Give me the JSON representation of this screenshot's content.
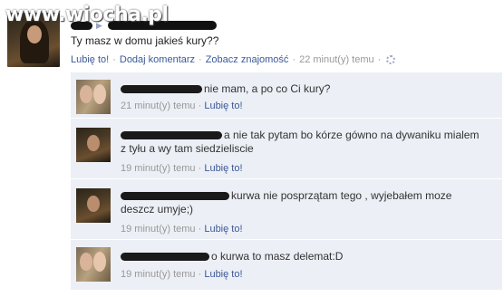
{
  "watermark": "www.wiocha.pl",
  "post": {
    "text": "Ty masz w domu jakieś kury??",
    "actions": {
      "like": "Lubię to!",
      "comment": "Dodaj komentarz",
      "friendship": "Zobacz znajomość",
      "time": "22 minut(y) temu"
    }
  },
  "comments": [
    {
      "text": "nie mam, a po co Ci kury?",
      "time": "21 minut(y) temu",
      "like": "Lubię to!"
    },
    {
      "text": "a nie tak pytam bo kórze gówno na dywaniku mialem z tyłu a wy tam siedzieliscie",
      "time": "19 minut(y) temu",
      "like": "Lubię to!"
    },
    {
      "text": "kurwa nie posprzątam tego , wyjebałem moze deszcz umyje;)",
      "time": "19 minut(y) temu",
      "like": "Lubię to!"
    },
    {
      "text": "o kurwa to masz delemat:D",
      "time": "19 minut(y) temu",
      "like": "Lubię to!"
    }
  ],
  "separator": "·",
  "colors": {
    "link": "#3b5998",
    "comment_bg": "#eceff5",
    "meta": "#999999"
  }
}
